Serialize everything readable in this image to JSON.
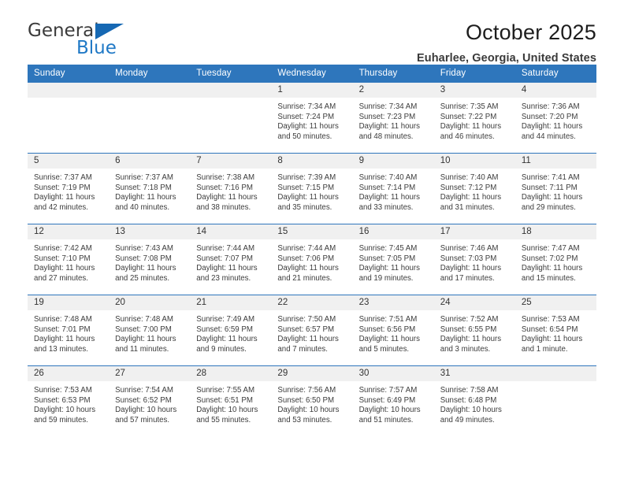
{
  "brand": {
    "name_part1": "General",
    "name_part2": "Blue",
    "accent_color": "#2079c6",
    "triangle_color": "#1668b3"
  },
  "header": {
    "title": "October 2025",
    "subtitle": "Euharlee, Georgia, United States"
  },
  "theme": {
    "header_row_bg": "#2e76bc",
    "daynum_band_bg": "#f0f0f0",
    "cell_border": "#2e76bc"
  },
  "weekdays": [
    "Sunday",
    "Monday",
    "Tuesday",
    "Wednesday",
    "Thursday",
    "Friday",
    "Saturday"
  ],
  "weeks": [
    [
      {
        "day": "",
        "empty": true
      },
      {
        "day": "",
        "empty": true
      },
      {
        "day": "",
        "empty": true
      },
      {
        "day": "1",
        "sunrise": "Sunrise: 7:34 AM",
        "sunset": "Sunset: 7:24 PM",
        "daylight1": "Daylight: 11 hours",
        "daylight2": "and 50 minutes."
      },
      {
        "day": "2",
        "sunrise": "Sunrise: 7:34 AM",
        "sunset": "Sunset: 7:23 PM",
        "daylight1": "Daylight: 11 hours",
        "daylight2": "and 48 minutes."
      },
      {
        "day": "3",
        "sunrise": "Sunrise: 7:35 AM",
        "sunset": "Sunset: 7:22 PM",
        "daylight1": "Daylight: 11 hours",
        "daylight2": "and 46 minutes."
      },
      {
        "day": "4",
        "sunrise": "Sunrise: 7:36 AM",
        "sunset": "Sunset: 7:20 PM",
        "daylight1": "Daylight: 11 hours",
        "daylight2": "and 44 minutes."
      }
    ],
    [
      {
        "day": "5",
        "sunrise": "Sunrise: 7:37 AM",
        "sunset": "Sunset: 7:19 PM",
        "daylight1": "Daylight: 11 hours",
        "daylight2": "and 42 minutes."
      },
      {
        "day": "6",
        "sunrise": "Sunrise: 7:37 AM",
        "sunset": "Sunset: 7:18 PM",
        "daylight1": "Daylight: 11 hours",
        "daylight2": "and 40 minutes."
      },
      {
        "day": "7",
        "sunrise": "Sunrise: 7:38 AM",
        "sunset": "Sunset: 7:16 PM",
        "daylight1": "Daylight: 11 hours",
        "daylight2": "and 38 minutes."
      },
      {
        "day": "8",
        "sunrise": "Sunrise: 7:39 AM",
        "sunset": "Sunset: 7:15 PM",
        "daylight1": "Daylight: 11 hours",
        "daylight2": "and 35 minutes."
      },
      {
        "day": "9",
        "sunrise": "Sunrise: 7:40 AM",
        "sunset": "Sunset: 7:14 PM",
        "daylight1": "Daylight: 11 hours",
        "daylight2": "and 33 minutes."
      },
      {
        "day": "10",
        "sunrise": "Sunrise: 7:40 AM",
        "sunset": "Sunset: 7:12 PM",
        "daylight1": "Daylight: 11 hours",
        "daylight2": "and 31 minutes."
      },
      {
        "day": "11",
        "sunrise": "Sunrise: 7:41 AM",
        "sunset": "Sunset: 7:11 PM",
        "daylight1": "Daylight: 11 hours",
        "daylight2": "and 29 minutes."
      }
    ],
    [
      {
        "day": "12",
        "sunrise": "Sunrise: 7:42 AM",
        "sunset": "Sunset: 7:10 PM",
        "daylight1": "Daylight: 11 hours",
        "daylight2": "and 27 minutes."
      },
      {
        "day": "13",
        "sunrise": "Sunrise: 7:43 AM",
        "sunset": "Sunset: 7:08 PM",
        "daylight1": "Daylight: 11 hours",
        "daylight2": "and 25 minutes."
      },
      {
        "day": "14",
        "sunrise": "Sunrise: 7:44 AM",
        "sunset": "Sunset: 7:07 PM",
        "daylight1": "Daylight: 11 hours",
        "daylight2": "and 23 minutes."
      },
      {
        "day": "15",
        "sunrise": "Sunrise: 7:44 AM",
        "sunset": "Sunset: 7:06 PM",
        "daylight1": "Daylight: 11 hours",
        "daylight2": "and 21 minutes."
      },
      {
        "day": "16",
        "sunrise": "Sunrise: 7:45 AM",
        "sunset": "Sunset: 7:05 PM",
        "daylight1": "Daylight: 11 hours",
        "daylight2": "and 19 minutes."
      },
      {
        "day": "17",
        "sunrise": "Sunrise: 7:46 AM",
        "sunset": "Sunset: 7:03 PM",
        "daylight1": "Daylight: 11 hours",
        "daylight2": "and 17 minutes."
      },
      {
        "day": "18",
        "sunrise": "Sunrise: 7:47 AM",
        "sunset": "Sunset: 7:02 PM",
        "daylight1": "Daylight: 11 hours",
        "daylight2": "and 15 minutes."
      }
    ],
    [
      {
        "day": "19",
        "sunrise": "Sunrise: 7:48 AM",
        "sunset": "Sunset: 7:01 PM",
        "daylight1": "Daylight: 11 hours",
        "daylight2": "and 13 minutes."
      },
      {
        "day": "20",
        "sunrise": "Sunrise: 7:48 AM",
        "sunset": "Sunset: 7:00 PM",
        "daylight1": "Daylight: 11 hours",
        "daylight2": "and 11 minutes."
      },
      {
        "day": "21",
        "sunrise": "Sunrise: 7:49 AM",
        "sunset": "Sunset: 6:59 PM",
        "daylight1": "Daylight: 11 hours",
        "daylight2": "and 9 minutes."
      },
      {
        "day": "22",
        "sunrise": "Sunrise: 7:50 AM",
        "sunset": "Sunset: 6:57 PM",
        "daylight1": "Daylight: 11 hours",
        "daylight2": "and 7 minutes."
      },
      {
        "day": "23",
        "sunrise": "Sunrise: 7:51 AM",
        "sunset": "Sunset: 6:56 PM",
        "daylight1": "Daylight: 11 hours",
        "daylight2": "and 5 minutes."
      },
      {
        "day": "24",
        "sunrise": "Sunrise: 7:52 AM",
        "sunset": "Sunset: 6:55 PM",
        "daylight1": "Daylight: 11 hours",
        "daylight2": "and 3 minutes."
      },
      {
        "day": "25",
        "sunrise": "Sunrise: 7:53 AM",
        "sunset": "Sunset: 6:54 PM",
        "daylight1": "Daylight: 11 hours",
        "daylight2": "and 1 minute."
      }
    ],
    [
      {
        "day": "26",
        "sunrise": "Sunrise: 7:53 AM",
        "sunset": "Sunset: 6:53 PM",
        "daylight1": "Daylight: 10 hours",
        "daylight2": "and 59 minutes."
      },
      {
        "day": "27",
        "sunrise": "Sunrise: 7:54 AM",
        "sunset": "Sunset: 6:52 PM",
        "daylight1": "Daylight: 10 hours",
        "daylight2": "and 57 minutes."
      },
      {
        "day": "28",
        "sunrise": "Sunrise: 7:55 AM",
        "sunset": "Sunset: 6:51 PM",
        "daylight1": "Daylight: 10 hours",
        "daylight2": "and 55 minutes."
      },
      {
        "day": "29",
        "sunrise": "Sunrise: 7:56 AM",
        "sunset": "Sunset: 6:50 PM",
        "daylight1": "Daylight: 10 hours",
        "daylight2": "and 53 minutes."
      },
      {
        "day": "30",
        "sunrise": "Sunrise: 7:57 AM",
        "sunset": "Sunset: 6:49 PM",
        "daylight1": "Daylight: 10 hours",
        "daylight2": "and 51 minutes."
      },
      {
        "day": "31",
        "sunrise": "Sunrise: 7:58 AM",
        "sunset": "Sunset: 6:48 PM",
        "daylight1": "Daylight: 10 hours",
        "daylight2": "and 49 minutes."
      },
      {
        "day": "",
        "empty": true
      }
    ]
  ]
}
